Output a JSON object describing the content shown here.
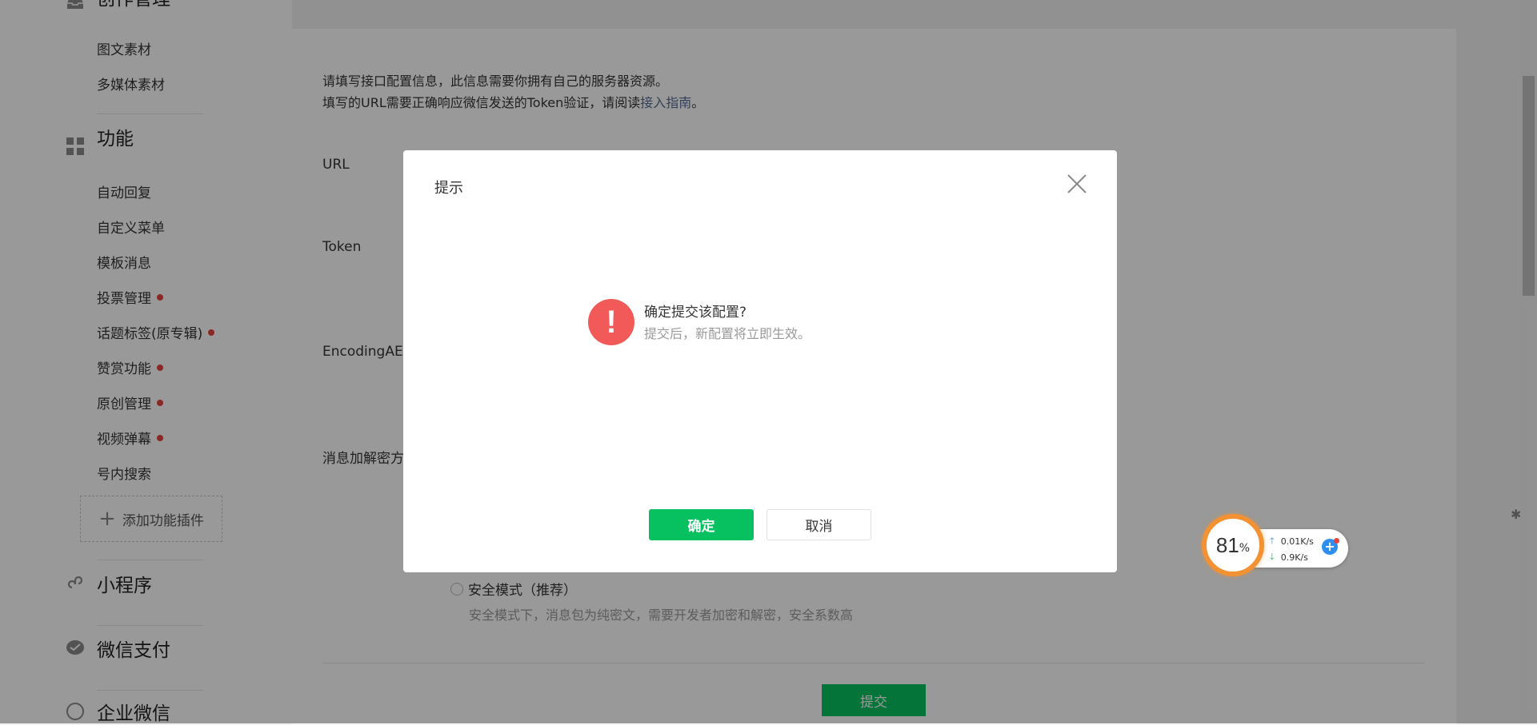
{
  "sidebar": {
    "groups": [
      {
        "title": "创作管理",
        "icon": "inbox-icon"
      },
      {
        "title": "功能",
        "icon": "grid-icon"
      },
      {
        "title": "小程序",
        "icon": "miniprogram-icon"
      },
      {
        "title": "微信支付",
        "icon": "wechat-pay-icon"
      },
      {
        "title": "企业微信",
        "icon": "work-wechat-icon"
      }
    ],
    "creation_items": [
      {
        "label": "图文素材",
        "dot": false
      },
      {
        "label": "多媒体素材",
        "dot": false
      }
    ],
    "function_items": [
      {
        "label": "自动回复",
        "dot": false
      },
      {
        "label": "自定义菜单",
        "dot": false
      },
      {
        "label": "模板消息",
        "dot": false
      },
      {
        "label": "投票管理",
        "dot": true
      },
      {
        "label": "话题标签(原专辑)",
        "dot": true
      },
      {
        "label": "赞赏功能",
        "dot": true
      },
      {
        "label": "原创管理",
        "dot": true
      },
      {
        "label": "视频弹幕",
        "dot": true
      },
      {
        "label": "号内搜索",
        "dot": false
      }
    ],
    "add_plugin_label": "添加功能插件"
  },
  "main": {
    "intro_line1": "请填写接口配置信息，此信息需要你拥有自己的服务器资源。",
    "intro_line2_prefix": "填写的URL需要正确响应微信发送的Token验证，请阅读",
    "intro_line2_link": "接入指南",
    "intro_line2_suffix": "。",
    "labels": {
      "url": "URL",
      "token": "Token",
      "encoding": "EncodingAES",
      "encrypt_mode": "消息加解密方"
    },
    "safe_mode_label": "安全模式（推荐）",
    "safe_mode_desc": "安全模式下，消息包为纯密文，需要开发者加密和解密，安全系数高",
    "submit_label": "提交"
  },
  "dialog": {
    "title": "提示",
    "message_title": "确定提交该配置?",
    "message_desc": "提交后，新配置将立即生效。",
    "confirm_label": "确定",
    "cancel_label": "取消",
    "colors": {
      "confirm": "#07c160",
      "warning": "#f25a5a"
    }
  },
  "net_widget": {
    "percent": "81",
    "percent_unit": "%",
    "upload": "0.01K/s",
    "download": "0.9K/s"
  }
}
